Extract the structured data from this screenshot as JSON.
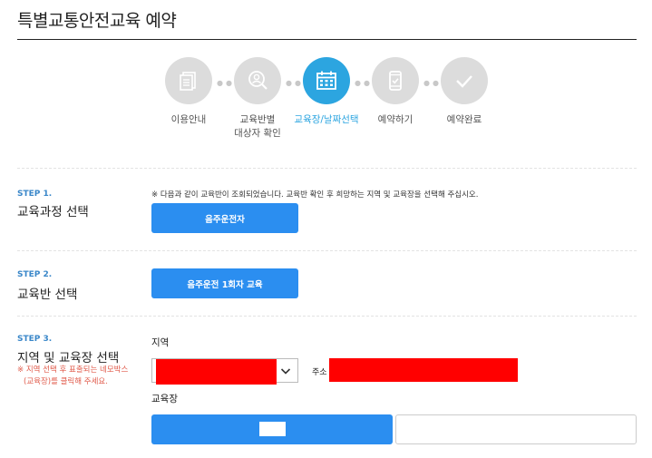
{
  "header": {
    "title": "특별교통안전교육 예약"
  },
  "steps": [
    {
      "label": "이용안내",
      "icon": "document-icon",
      "active": false
    },
    {
      "label": "교육반별\n대상자 확인",
      "icon": "user-search-icon",
      "active": false
    },
    {
      "label": "교육장/날짜선택",
      "icon": "calendar-icon",
      "active": true
    },
    {
      "label": "예약하기",
      "icon": "phone-check-icon",
      "active": false
    },
    {
      "label": "예약완료",
      "icon": "check-icon",
      "active": false
    }
  ],
  "step1": {
    "no": "STEP 1.",
    "title": "교육과정 선택",
    "notice": "※ 다음과 같이 교육반이 조회되었습니다. 교육반 확인 후 희망하는 지역 및 교육장을 선택해 주십시오.",
    "button": "음주운전자"
  },
  "step2": {
    "no": "STEP 2.",
    "title": "교육반 선택",
    "button": "음주운전 1회자 교육"
  },
  "step3": {
    "no": "STEP 3.",
    "title": "지역 및 교육장 선택",
    "note_line1": "※ 지역 선택 후 표출되는 네모박스",
    "note_line2": "(교육장)를 클릭해 주세요.",
    "region_label": "지역",
    "address_label": "주소",
    "venue_label": "교육장"
  },
  "colors": {
    "accent": "#2ca5e0",
    "button": "#2b8ef0",
    "note": "#e05a4a",
    "redacted": "#ff0000"
  }
}
